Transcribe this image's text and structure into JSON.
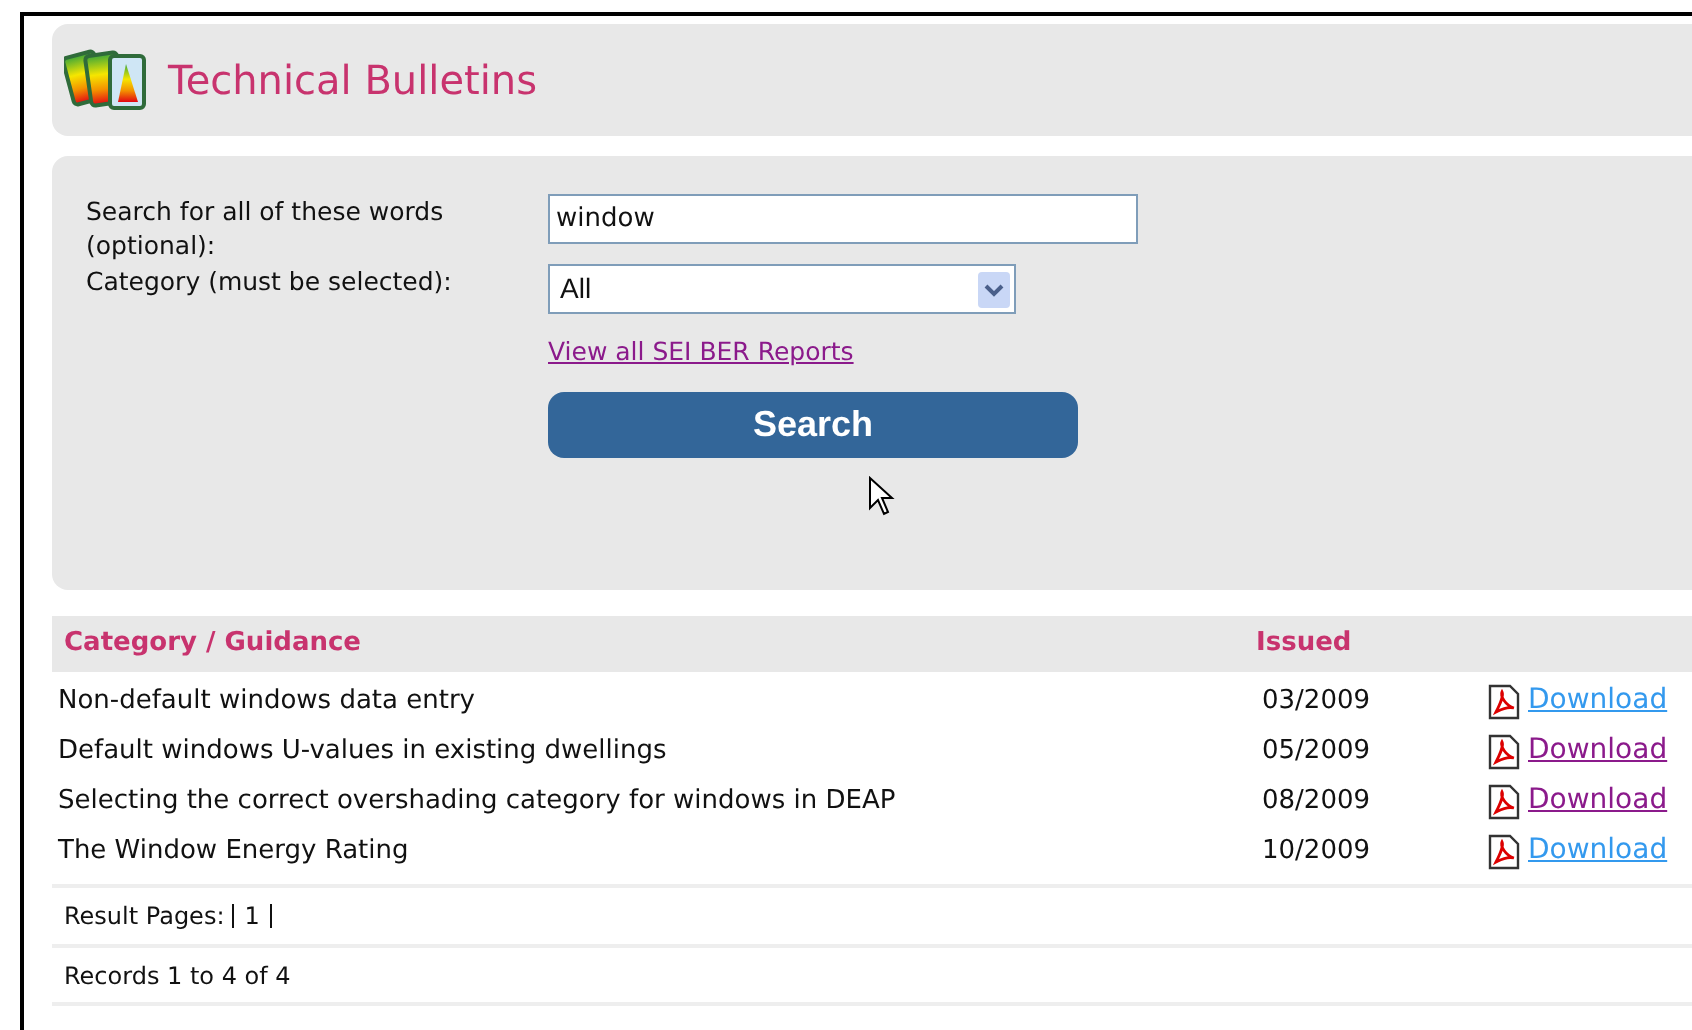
{
  "header": {
    "title": "Technical Bulletins"
  },
  "search_form": {
    "words_label": "Search for all of these words (optional):",
    "words_value": "window",
    "category_label": "Category (must be selected):",
    "category_value": "All",
    "reports_link": "View all SEI BER Reports",
    "search_button": "Search"
  },
  "table": {
    "columns": [
      "Category / Guidance",
      "Issued"
    ],
    "rows": [
      {
        "title": "Non-default windows data entry",
        "issued": "03/2009",
        "link": "Download",
        "visited": false
      },
      {
        "title": "Default windows U-values in existing dwellings",
        "issued": "05/2009",
        "link": "Download",
        "visited": true
      },
      {
        "title": "Selecting the correct overshading category for windows in DEAP",
        "issued": "08/2009",
        "link": "Download",
        "visited": true
      },
      {
        "title": "The Window Energy Rating",
        "issued": "10/2009",
        "link": "Download",
        "visited": false
      }
    ]
  },
  "result_pages": {
    "label": "Result Pages:",
    "pages": [
      "1"
    ]
  },
  "records": "Records 1 to 4 of 4"
}
